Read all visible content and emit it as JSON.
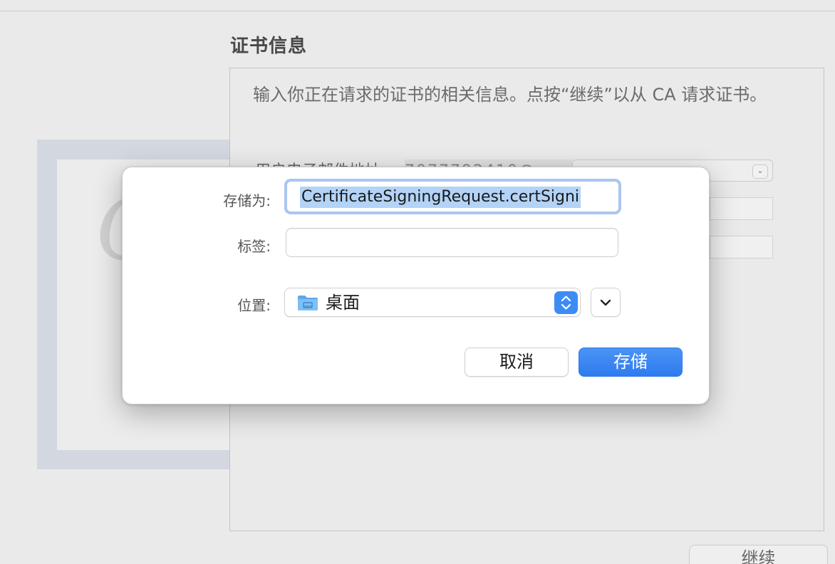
{
  "background": {
    "title": "证书信息",
    "description": "输入你正在请求的证书的相关信息。点按“继续”以从 CA 请求证书。",
    "partial_label": "用户电子邮件地址",
    "partial_value": "7077792410@",
    "continue_label": "继续"
  },
  "sheet": {
    "save_as_label": "存储为:",
    "filename_value": "CertificateSigningRequest.certSigni",
    "tags_label": "标签:",
    "tags_value": "",
    "location_label": "位置:",
    "location_value": "桌面",
    "cancel_label": "取消",
    "save_label": "存储"
  },
  "colors": {
    "accent": "#3b86f1",
    "selection": "#b3d3f7",
    "focus_ring": "#a9c6ef"
  }
}
